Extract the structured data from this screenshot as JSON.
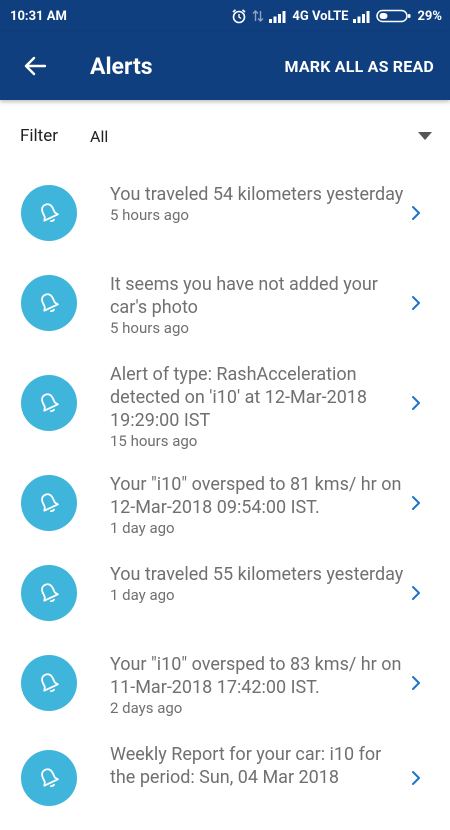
{
  "status_bar": {
    "time": "10:31 AM",
    "network": "4G VoLTE",
    "battery": "29%"
  },
  "app_bar": {
    "title": "Alerts",
    "action_label": "MARK ALL AS READ",
    "back_icon": "arrow-back-icon"
  },
  "filter": {
    "label": "Filter",
    "selected": "All"
  },
  "colors": {
    "primary": "#0f3f7f",
    "icon_circle": "#3fb5dc",
    "chevron": "#1e73c8",
    "text_secondary": "#707070"
  },
  "alerts": [
    {
      "message": "You traveled 54 kilometers yesterday",
      "time": "5 hours ago"
    },
    {
      "message": "It seems you have not added your car's photo",
      "time": "5 hours ago"
    },
    {
      "message": "Alert of type: RashAcceleration detected on 'i10' at 12-Mar-2018 19:29:00 IST",
      "time": "15 hours ago"
    },
    {
      "message": "Your \"i10\" oversped to 81 kms/ hr on 12-Mar-2018 09:54:00 IST.",
      "time": "1 day ago"
    },
    {
      "message": "You traveled 55 kilometers yesterday",
      "time": "1 day ago"
    },
    {
      "message": "Your \"i10\" oversped to 83 kms/ hr on 11-Mar-2018 17:42:00 IST.",
      "time": "2 days ago"
    },
    {
      "message": "Weekly Report for your car: i10 for the period: Sun, 04 Mar 2018",
      "time": ""
    }
  ]
}
